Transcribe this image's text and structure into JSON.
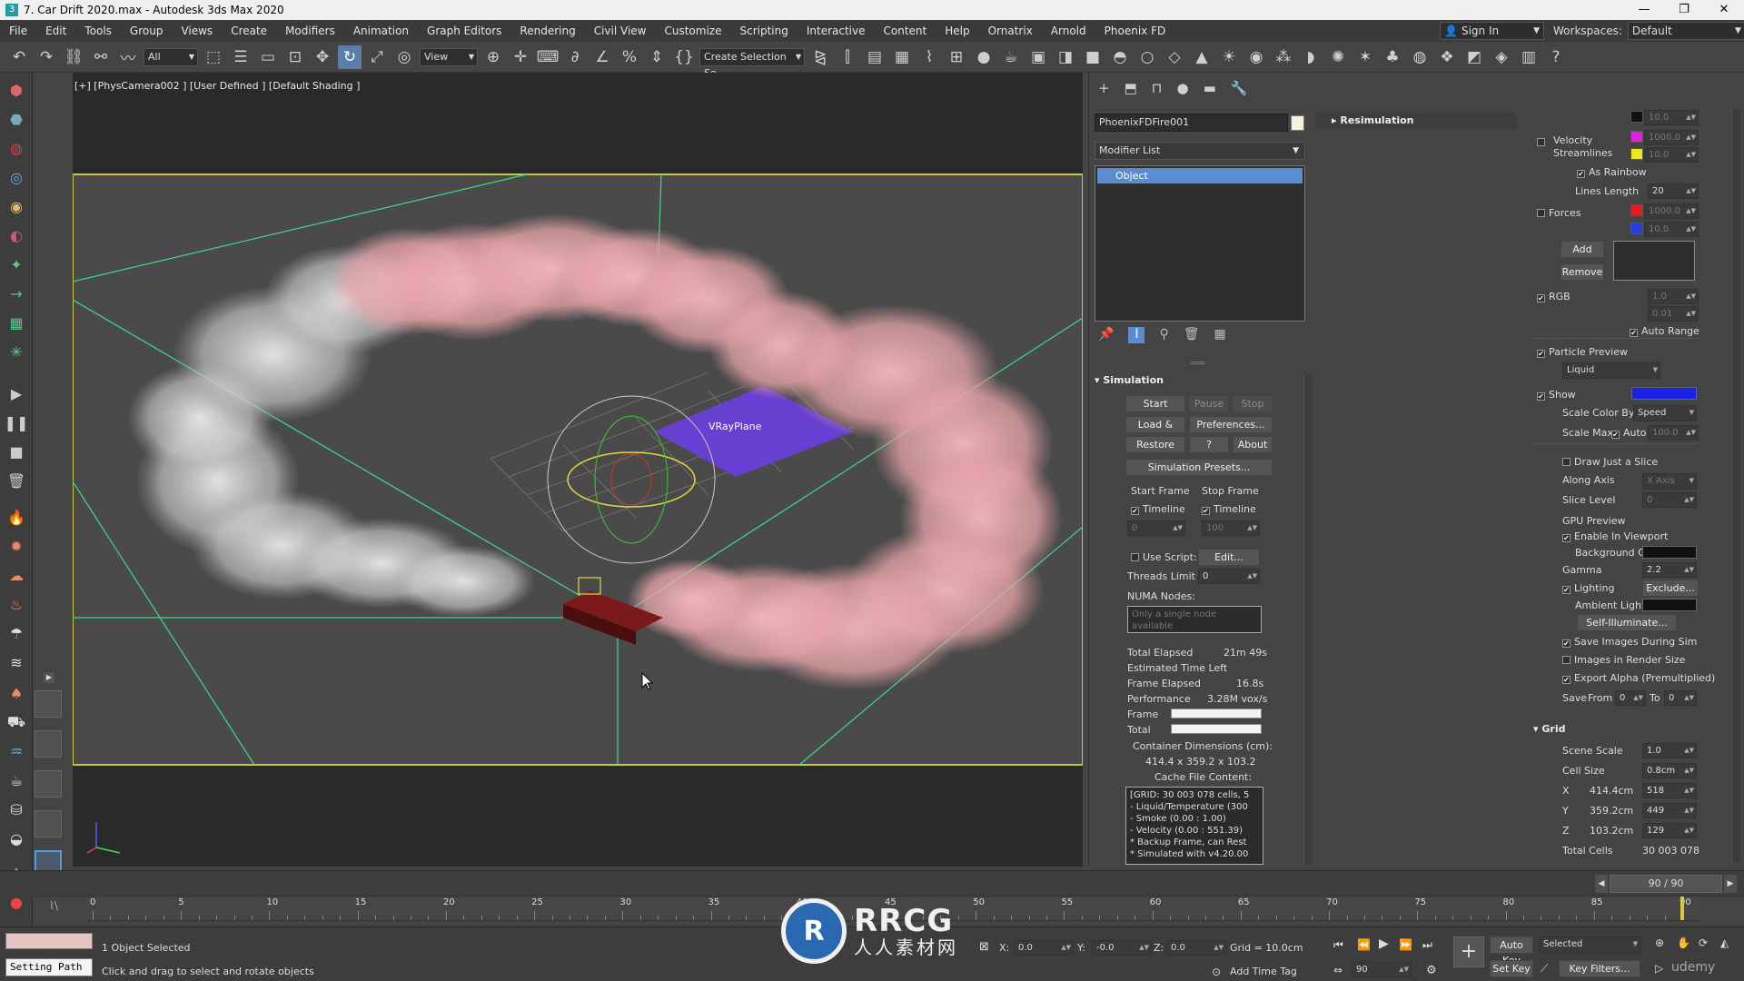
{
  "window": {
    "title": "7. Car Drift 2020.max - Autodesk 3ds Max 2020",
    "minimize": "—",
    "restore": "❐",
    "close": "✕"
  },
  "menu": [
    "File",
    "Edit",
    "Tools",
    "Group",
    "Views",
    "Create",
    "Modifiers",
    "Animation",
    "Graph Editors",
    "Rendering",
    "Civil View",
    "Customize",
    "Scripting",
    "Interactive",
    "Content",
    "Help",
    "Ornatrix",
    "Arnold",
    "Phoenix FD"
  ],
  "account": {
    "sign_in": "Sign In",
    "workspaces_label": "Workspaces:",
    "workspace": "Default"
  },
  "toolbar": {
    "filter": "All",
    "coord": "View",
    "selection_set": "Create Selection Se"
  },
  "viewport": {
    "label": "[+] [PhysCamera002 ] [User Defined ] [Default Shading ]",
    "plane_label": "VRayPlane",
    "colors": {
      "smoke": "#e8a9ad",
      "grid_lines": "#3fd88a",
      "frame": "#d8d84a",
      "plane": "#6a3fe0"
    }
  },
  "command_panel": {
    "object_name": "PhoenixFDFire001",
    "modifier_list": "Modifier List",
    "stack_item": "Object",
    "simulation": {
      "header": "Simulation",
      "start": "Start",
      "pause": "Pause",
      "stop": "Stop",
      "load_start": "Load & Start",
      "preferences": "Preferences...",
      "restore": "Restore",
      "help": "?",
      "about": "About",
      "presets": "Simulation Presets...",
      "start_frame": "Start Frame",
      "stop_frame": "Stop Frame",
      "timeline": "Timeline",
      "start_frame_value": "0",
      "stop_frame_value": "100",
      "use_script": "Use Script:",
      "edit": "Edit...",
      "threads_limit": "Threads Limit",
      "threads_value": "0",
      "numa_nodes": "NUMA Nodes:",
      "numa_placeholder": "Only a single node available",
      "total_elapsed_label": "Total Elapsed",
      "total_elapsed": "21m 49s",
      "estimated_label": "Estimated Time Left",
      "frame_elapsed_label": "Frame Elapsed",
      "frame_elapsed": "16.8s",
      "performance_label": "Performance",
      "performance": "3.28M vox/s",
      "frame_label": "Frame",
      "total_label": "Total",
      "frame_progress": 1.0,
      "total_progress": 1.0,
      "container_label": "Container Dimensions (cm):",
      "container_value": "414.4 x 359.2 x 103.2",
      "cache_label": "Cache File Content:",
      "cache_lines": [
        "[GRID: 30 003 078 cells, 5",
        "- Liquid/Temperature (300",
        "- Smoke (0.00 : 1.00)",
        "- Velocity (0.00 : 551.39)",
        "* Backup Frame, can Rest",
        "* Simulated with v4.20.00"
      ]
    },
    "resimulation": "Resimulation"
  },
  "preview_panel": {
    "val_10a": "10.0",
    "velocity": "Velocity",
    "streamlines": "Streamlines",
    "val_1000a": "1000.0",
    "val_10b": "10.0",
    "as_rainbow": "As Rainbow",
    "lines_length": "Lines Length",
    "lines_length_value": "20",
    "forces": "Forces",
    "val_1000b": "1000.0",
    "val_10c": "10.0",
    "add": "Add",
    "remove": "Remove",
    "rgb": "RGB",
    "val_1": "1.0",
    "val_001": "0.01",
    "auto_range": "Auto Range",
    "particle_preview": "Particle Preview",
    "particle_type": "Liquid",
    "show": "Show",
    "scale_color_by": "Scale Color By",
    "scale_color_value": "Speed",
    "scale_max": "Scale Max",
    "auto": "Auto",
    "scale_max_value": "100.0",
    "draw_slice": "Draw Just a Slice",
    "along_axis": "Along Axis",
    "axis_value": "X Axis",
    "slice_level": "Slice Level",
    "slice_value": "0",
    "gpu_preview": "GPU Preview",
    "enable_viewport": "Enable In Viewport",
    "background_color": "Background Color",
    "gamma": "Gamma",
    "gamma_value": "2.2",
    "lighting": "Lighting",
    "exclude": "Exclude...",
    "ambient_light": "Ambient Light",
    "self_illuminate": "Self-Illuminate...",
    "save_images": "Save Images During Sim",
    "images_render": "Images in Render Size",
    "export_alpha": "Export Alpha (Premultiplied)",
    "save": "Save",
    "from": "From",
    "from_value": "0",
    "to": "To",
    "to_value": "0",
    "grid": "Grid",
    "scene_scale": "Scene Scale",
    "scene_scale_value": "1.0",
    "cell_size": "Cell Size",
    "cell_size_value": "0.8cm",
    "x": "X",
    "x_cm": "414.4cm",
    "x_cells": "518",
    "y": "Y",
    "y_cm": "359.2cm",
    "y_cells": "449",
    "z": "Z",
    "z_cm": "103.2cm",
    "z_cells": "129",
    "total_cells": "Total Cells",
    "total_cells_value": "30 003 078",
    "swatch_colors": [
      "#111111",
      "#e020e0",
      "#e8e820",
      "#e02020",
      "#2040e0"
    ]
  },
  "timeline": {
    "frame_display": "90 / 90",
    "current": 90,
    "max": 90,
    "ticks": [
      "0",
      "5",
      "10",
      "15",
      "20",
      "25",
      "30",
      "35",
      "40",
      "45",
      "50",
      "55",
      "60",
      "65",
      "70",
      "75",
      "80",
      "85",
      "90"
    ]
  },
  "status": {
    "script_field": "Setting Path",
    "selected": "1 Object Selected",
    "prompt": "Click and drag to select and rotate objects",
    "x_label": "X:",
    "x_value": "0.0",
    "y_label": "Y:",
    "y_value": "-0.0",
    "z_label": "Z:",
    "z_value": "0.0",
    "grid": "Grid = 10.0cm",
    "add_time_tag": "Add Time Tag",
    "auto_key": "Auto Key",
    "selected_mode": "Selected",
    "set_key": "Set Key",
    "key_filters": "Key Filters...",
    "frame_field": "90"
  },
  "watermark": {
    "logo": "R",
    "brand": "RRCG",
    "brand_cn": "人人素材网",
    "corner": "udemy"
  }
}
